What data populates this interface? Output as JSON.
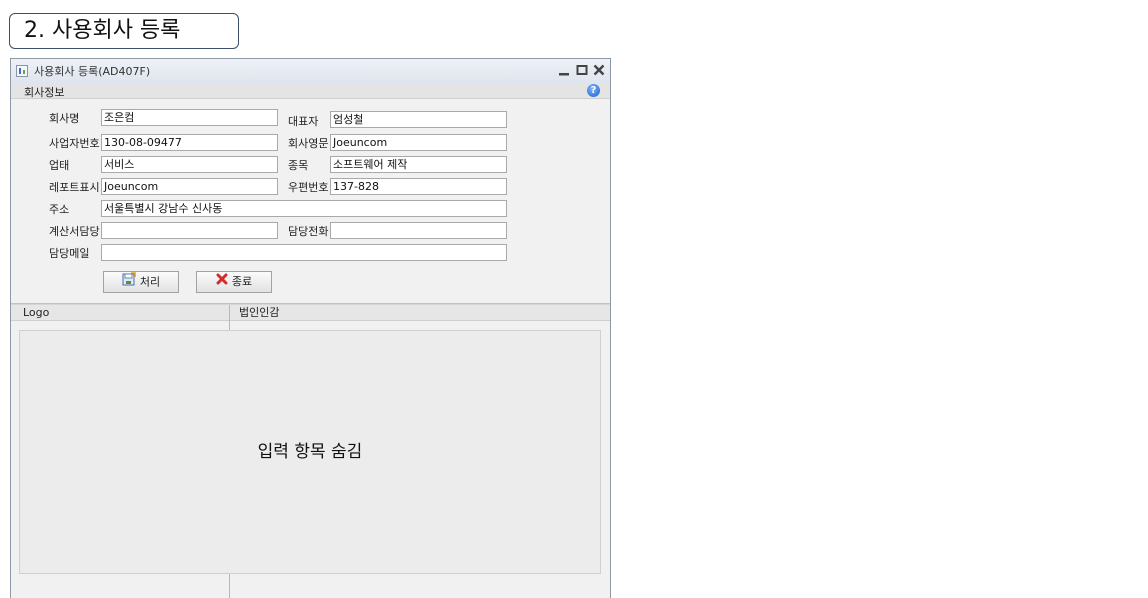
{
  "section_title": "2. 사용회사 등록",
  "window": {
    "title": "사용회사 등록(AD407F)",
    "group_label": "회사정보"
  },
  "form": {
    "company_name": {
      "label": "회사명",
      "value": "조은컴"
    },
    "ceo": {
      "label": "대표자",
      "value": "엄성철"
    },
    "biz_no": {
      "label": "사업자번호",
      "value": "130-08-09477"
    },
    "english_name": {
      "label": "회사영문",
      "value": "Joeuncom"
    },
    "biz_type": {
      "label": "업태",
      "value": "서비스"
    },
    "biz_item": {
      "label": "종목",
      "value": "소프트웨어 제작"
    },
    "report_display": {
      "label": "레포트표시",
      "value": "Joeuncom"
    },
    "postal_code": {
      "label": "우편번호",
      "value": "137-828"
    },
    "address": {
      "label": "주소",
      "value": "서울특별시 강남수 신사동"
    },
    "invoice_contact": {
      "label": "계산서담당",
      "value": ""
    },
    "contact_phone": {
      "label": "담당전화",
      "value": ""
    },
    "contact_email": {
      "label": "담당메일",
      "value": ""
    }
  },
  "buttons": {
    "process": "처리",
    "close": "종료"
  },
  "tabs": {
    "logo": "Logo",
    "seal": "법인인감"
  },
  "hidden_message": "입력 항목 숨김"
}
